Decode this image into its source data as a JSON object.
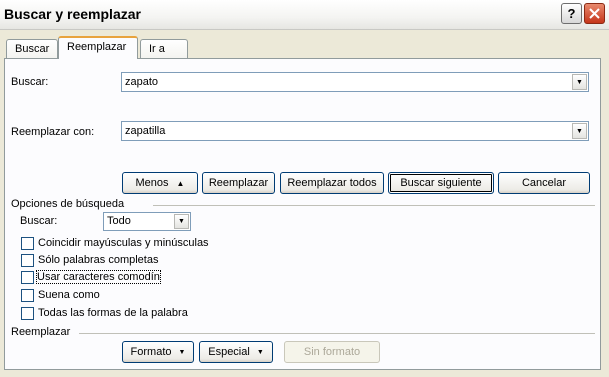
{
  "window": {
    "title": "Buscar y reemplazar"
  },
  "tabs": [
    {
      "label": "Buscar"
    },
    {
      "label": "Reemplazar"
    },
    {
      "label": "Ir a"
    }
  ],
  "find": {
    "label": "Buscar:",
    "value": "zapato"
  },
  "replace": {
    "label": "Reemplazar con:",
    "value": "zapatilla"
  },
  "buttons": {
    "less": "Menos",
    "less_arrow": "▲",
    "replace": "Reemplazar",
    "replace_all": "Reemplazar todos",
    "find_next": "Buscar siguiente",
    "cancel": "Cancelar"
  },
  "search_options": {
    "header": "Opciones de búsqueda",
    "direction_label": "Buscar:",
    "direction_value": "Todo",
    "checkboxes": [
      {
        "label": "Coincidir mayúsculas y minúsculas",
        "checked": false
      },
      {
        "label": "Sólo palabras completas",
        "checked": false
      },
      {
        "label": "Usar caracteres comodín",
        "checked": false
      },
      {
        "label": "Suena como",
        "checked": false
      },
      {
        "label": "Todas las formas de la palabra",
        "checked": false
      }
    ]
  },
  "replace_section": {
    "header": "Reemplazar",
    "format": "Formato",
    "special": "Especial",
    "no_format": "Sin formato",
    "dropdown_arrow": "▼"
  },
  "colors": {
    "accent_tab": "#E8A33D",
    "close_button": "#C5351A",
    "dialog_bg": "#ECE9D8"
  }
}
